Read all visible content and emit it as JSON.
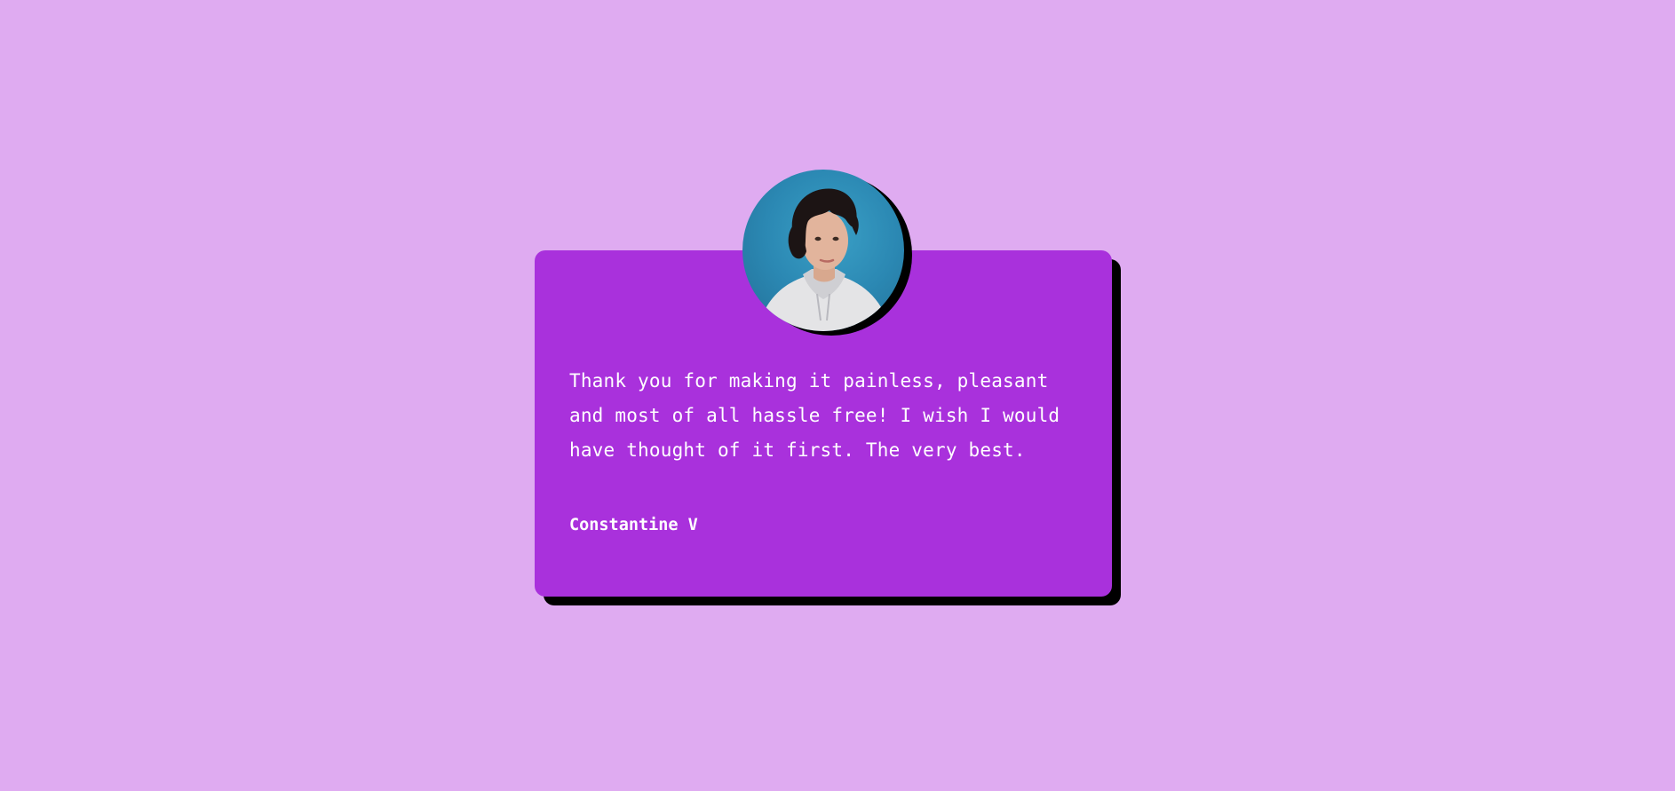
{
  "colors": {
    "page_background": "#dfabf1",
    "card_background": "#a931dc",
    "card_shadow": "#000000",
    "text": "#ffffff"
  },
  "testimonial": {
    "avatar_icon": "person-portrait",
    "quote": "Thank you for making it painless, pleasant and most of all hassle free! I wish I would have thought of it first. The very best.",
    "author": "Constantine V"
  }
}
